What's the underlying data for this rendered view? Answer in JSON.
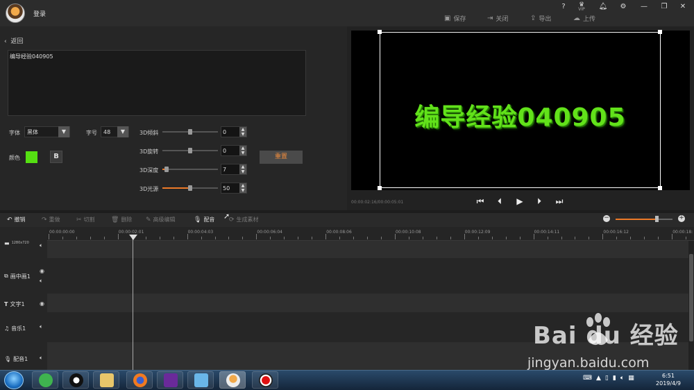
{
  "titlebar": {
    "login_label": "登录",
    "vip_label": "VIP",
    "help": "?",
    "toolbar": {
      "save": "保存",
      "close": "关闭",
      "export": "导出",
      "upload": "上传"
    }
  },
  "editor": {
    "back_label": "返回",
    "text_value": "编导经验040905",
    "font_label": "字体",
    "font_value": "黑体",
    "size_label": "字号",
    "size_value": "48",
    "color_label": "颜色",
    "color_value": "#55e012",
    "bold_label": "B",
    "sliders": [
      {
        "label": "3D倾斜",
        "value": "0",
        "fraction": 0.5
      },
      {
        "label": "3D旋转",
        "value": "0",
        "fraction": 0.5
      },
      {
        "label": "3D深度",
        "value": "7",
        "fraction": 0.07
      },
      {
        "label": "3D光源",
        "value": "50",
        "fraction": 0.5
      }
    ],
    "reset_label": "重置"
  },
  "preview": {
    "text": "编导经验040905",
    "timecode": "00:00:02:16/00:00:05:01"
  },
  "edit_tools": [
    {
      "label": "撤销",
      "enabled": true
    },
    {
      "label": "重做",
      "enabled": false
    },
    {
      "label": "切割",
      "enabled": false
    },
    {
      "label": "删除",
      "enabled": false
    },
    {
      "label": "高级编辑",
      "enabled": false
    },
    {
      "label": "配音",
      "enabled": true
    },
    {
      "label": "生成素材",
      "enabled": false
    }
  ],
  "ruler": {
    "labels": [
      "00:00:00:00",
      "00:00:02:01",
      "00:00:04:03",
      "00:00:06:04",
      "00:00:08:06",
      "00:00:10:08",
      "00:00:12:09",
      "00:00:14:11",
      "00:00:16:12",
      "00:00:18:"
    ]
  },
  "tracks": [
    {
      "label": "",
      "first_clip_label": "1280x720"
    },
    {
      "label": "画中画1"
    },
    {
      "label": "文字1"
    },
    {
      "label": "音乐1"
    },
    {
      "label": "配音1"
    }
  ],
  "taskbar": {
    "time": "6:51",
    "date": "2019/4/9"
  },
  "watermark": {
    "logo": "Bai du 经验",
    "subtitle": "jingyan.baidu.com"
  },
  "colors": {
    "accent": "#ee7a28",
    "text_green": "#62e21a",
    "reset_text": "#f08c3c"
  }
}
